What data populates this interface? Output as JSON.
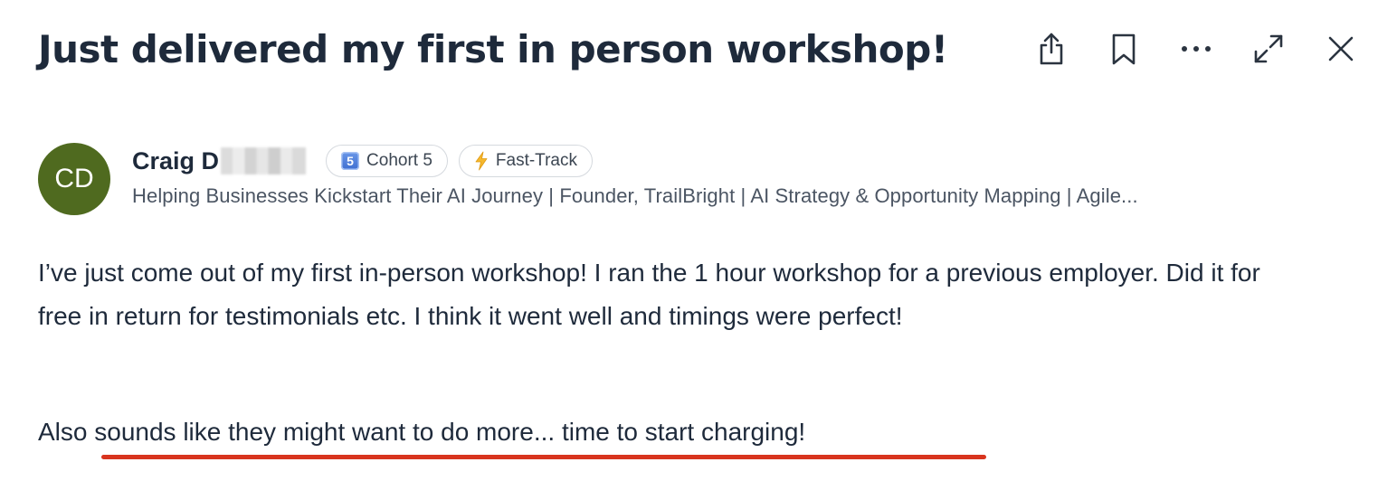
{
  "post": {
    "title": "Just delivered my first in person workshop!",
    "author": {
      "initials": "CD",
      "name": "Craig D",
      "headline": "Helping Businesses Kickstart Their AI Journey | Founder, TrailBright | AI Strategy & Opportunity Mapping | Agile..."
    },
    "badges": [
      {
        "icon": "keycap-5-icon",
        "keycap": "5",
        "label": "Cohort 5"
      },
      {
        "icon": "lightning-icon",
        "label": "Fast-Track"
      }
    ],
    "paragraphs": [
      "I’ve just come out of my first in-person workshop! I ran the 1 hour workshop for a previous employer. Did it for free in return for testimonials etc.  I think it went well and timings were perfect!",
      "Also sounds like they might want to do more... time to start charging!"
    ]
  },
  "toolbar": {
    "icons": [
      "share-icon",
      "bookmark-icon",
      "more-icon",
      "expand-icon",
      "close-icon"
    ]
  },
  "colors": {
    "avatar_bg": "#4f6a1f",
    "annotation_underline": "#d8341e",
    "title_text": "#1e2a3b"
  }
}
